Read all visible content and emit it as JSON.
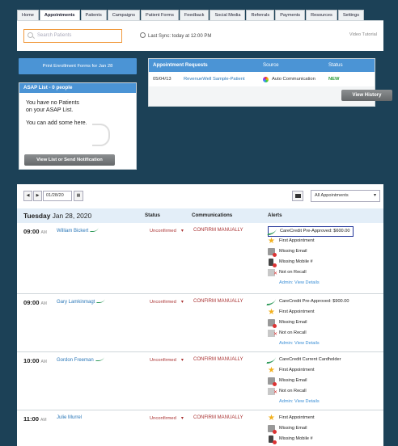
{
  "nav": {
    "tabs": [
      "Home",
      "Appointments",
      "Patients",
      "Campaigns",
      "Patient Forms",
      "Feedback",
      "Social Media",
      "Referrals",
      "Payments",
      "Resources",
      "Settings"
    ],
    "active": "Appointments"
  },
  "topbar": {
    "search_placeholder": "Search Patients",
    "last_sync": "Last Sync: today at 12:00 PM",
    "video_tutorial": "Video Tutorial"
  },
  "left": {
    "print_button": "Print Enrollment Forms for Jan 28",
    "asap_title": "ASAP List - 0 people",
    "asap_msg1": "You have no Patients on your ASAP List.",
    "asap_msg2": "You can add some here.",
    "asap_button": "View List or Send Notification"
  },
  "requests": {
    "col_title": "Appointment Requests",
    "col_source": "Source",
    "col_status": "Status",
    "row": {
      "date": "05/04/13",
      "patient": "RevenueWell Sample-Patient",
      "source": "Auto Communication",
      "status": "NEW"
    },
    "history_button": "View History"
  },
  "calendar": {
    "date_value": "01/28/20",
    "filter": "All Appointments",
    "day_name": "Tuesday",
    "day_date": "Jan 28, 2020",
    "col_status": "Status",
    "col_comm": "Communications",
    "col_alerts": "Alerts"
  },
  "appointments": [
    {
      "time": "09:00",
      "ampm": "AM",
      "name": "William Bickert",
      "status": "Unconfirmed",
      "comm": "CONFIRM MANUALLY",
      "alerts": [
        {
          "icon": "carecredit-icon",
          "text": "CareCredit Pre-Approved: $600.00"
        },
        {
          "icon": "star-icon",
          "text": "First Appointment"
        },
        {
          "icon": "missing-email-icon",
          "text": "Missing Email"
        },
        {
          "icon": "missing-mobile-icon",
          "text": "Missing Mobile #"
        },
        {
          "icon": "recall-icon",
          "text": "Not on Recall"
        }
      ],
      "admin": "Admin: View Details"
    },
    {
      "time": "09:00",
      "ampm": "AM",
      "name": "Gary Lamkinmagt",
      "status": "Unconfirmed",
      "comm": "CONFIRM MANUALLY",
      "alerts": [
        {
          "icon": "carecredit-icon",
          "text": "CareCredit Pre-Approved: $900.00"
        },
        {
          "icon": "star-icon",
          "text": "First Appointment"
        },
        {
          "icon": "missing-email-icon",
          "text": "Missing Email"
        },
        {
          "icon": "recall-icon",
          "text": "Not on Recall"
        }
      ],
      "admin": "Admin: View Details"
    },
    {
      "time": "10:00",
      "ampm": "AM",
      "name": "Gordon Freeman",
      "status": "Unconfirmed",
      "comm": "CONFIRM MANUALLY",
      "alerts": [
        {
          "icon": "carecredit-icon",
          "text": "CareCredit Current Cardholder"
        },
        {
          "icon": "star-icon",
          "text": "First Appointment"
        },
        {
          "icon": "missing-email-icon",
          "text": "Missing Email"
        },
        {
          "icon": "recall-icon",
          "text": "Not on Recall"
        }
      ],
      "admin": "Admin: View Details"
    },
    {
      "time": "11:00",
      "ampm": "AM",
      "name": "Julie Murrel",
      "status": "Unconfirmed",
      "comm": "CONFIRM MANUALLY",
      "alerts": [
        {
          "icon": "star-icon",
          "text": "First Appointment"
        },
        {
          "icon": "missing-email-icon",
          "text": "Missing Email"
        },
        {
          "icon": "missing-mobile-icon",
          "text": "Missing Mobile #"
        }
      ],
      "admin": ""
    }
  ]
}
